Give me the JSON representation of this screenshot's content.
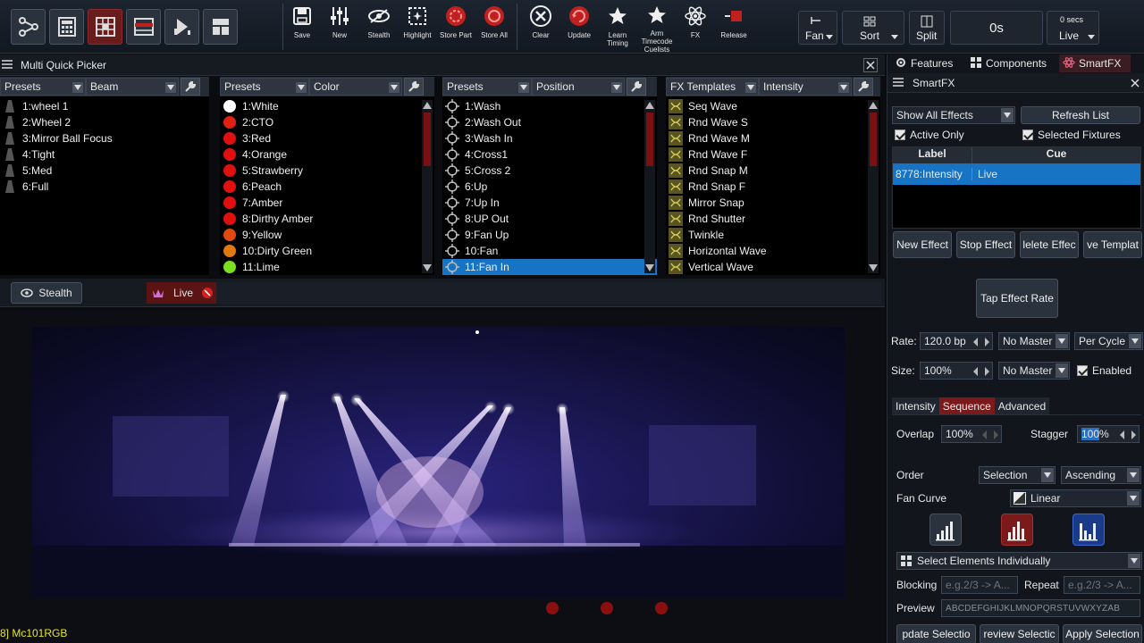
{
  "colors": {
    "accent_red": "#c0201e",
    "selection_blue": "#1773c4",
    "status_yellow": "#e6e62a"
  },
  "toolbar": {
    "mode_icons": [
      "nodes-icon",
      "calculator-icon",
      "grid-icon",
      "table-icon",
      "playback-icon",
      "layout-icon"
    ],
    "buttons": [
      {
        "label": "Save",
        "icon": "save-icon"
      },
      {
        "label": "New",
        "icon": "faders-icon"
      },
      {
        "label": "Stealth",
        "icon": "eye-icon"
      },
      {
        "label": "Highlight",
        "icon": "highlight-icon"
      },
      {
        "label": "Store Part",
        "icon": "store-part-icon"
      },
      {
        "label": "Store All",
        "icon": "store-all-icon"
      },
      {
        "label": "Clear",
        "icon": "clear-icon"
      },
      {
        "label": "Update",
        "icon": "update-icon"
      },
      {
        "label": "Learn Timing",
        "icon": "star-icon"
      },
      {
        "label": "Arm Timecode Cuelists",
        "icon": "star-icon"
      },
      {
        "label": "FX",
        "icon": "atom-icon"
      },
      {
        "label": "Release",
        "icon": "release-icon"
      }
    ],
    "fan_label": "Fan",
    "sort_label": "Sort",
    "split_label": "Split",
    "time_value": "0s",
    "live_secs": "0 secs",
    "live_label": "Live"
  },
  "picker": {
    "title": "Multi Quick Picker",
    "columns": [
      {
        "header_left": "Presets",
        "header_right": "Beam",
        "items": [
          "1:wheel 1",
          "2:Wheel 2",
          "3:Mirror Ball Focus",
          "4:Tight",
          "5:Med",
          "6:Full"
        ]
      },
      {
        "header_left": "Presets",
        "header_right": "Color",
        "items": [
          "1:White",
          "2:CTO",
          "3:Red",
          "4:Orange",
          "5:Strawberry",
          "6:Peach",
          "7:Amber",
          "8:Dirthy Amber",
          "9:Yellow",
          "10:Dirty Green",
          "11:Lime"
        ],
        "swatches": [
          "#ffffff",
          "#e02010",
          "#e01010",
          "#e01010",
          "#e01010",
          "#e01010",
          "#e01010",
          "#e01010",
          "#e04a10",
          "#e07a10",
          "#7ae020"
        ]
      },
      {
        "header_left": "Presets",
        "header_right": "Position",
        "items": [
          "1:Wash",
          "2:Wash Out",
          "3:Wash In",
          "4:Cross1",
          "5:Cross 2",
          "6:Up",
          "7:Up In",
          "8:UP Out",
          "9:Fan Up",
          "10:Fan",
          "11:Fan In"
        ],
        "selected": "11:Fan In"
      },
      {
        "header_left": "FX Templates",
        "header_right": "Intensity",
        "items": [
          "Seq Wave",
          "Rnd Wave S",
          "Rnd Wave M",
          "Rnd Wave F",
          "Rnd Snap M",
          "Rnd Snap F",
          "Mirror Snap",
          "Rnd Shutter",
          "Twinkle",
          "Horizontal Wave",
          "Vertical Wave"
        ]
      }
    ]
  },
  "viewbar": {
    "stealth_label": "Stealth",
    "live_label": "Live"
  },
  "status": {
    "fixture_text": "8] Mc101RGB"
  },
  "rpanel": {
    "tabs": [
      "Features",
      "Components",
      "SmartFX"
    ],
    "title": "SmartFX",
    "show_filter": "Show All Effects",
    "refresh_label": "Refresh List",
    "active_only": "Active Only",
    "selected_fixtures": "Selected Fixtures",
    "table_headers": [
      "Label",
      "Cue"
    ],
    "table_rows": [
      {
        "label": "8778:Intensity",
        "cue": "Live"
      }
    ],
    "actions": [
      "New Effect",
      "Stop Effect",
      "lelete Effec",
      "ve Templat"
    ],
    "tap_rate": "Tap Effect Rate",
    "rate_label": "Rate:",
    "rate_value": "120.0 bp",
    "rate_master": "No Master",
    "rate_mode": "Per Cycle",
    "size_label": "Size:",
    "size_value": "100%",
    "size_master": "No Master",
    "enabled_label": "Enabled",
    "subtabs": [
      "Intensity",
      "Sequence",
      "Advanced"
    ],
    "overlap_label": "Overlap",
    "overlap_value": "100%",
    "stagger_label": "Stagger",
    "stagger_value": "100",
    "stagger_unit": "%",
    "order_label": "Order",
    "order_value": "Selection",
    "order_dir": "Ascending",
    "fancurve_label": "Fan Curve",
    "fancurve_value": "Linear",
    "select_mode": "Select Elements Individually",
    "blocking_label": "Blocking",
    "blocking_placeholder": "e.g.2/3 -> A...",
    "repeat_label": "Repeat",
    "repeat_placeholder": "e.g.2/3 -> A...",
    "preview_label": "Preview",
    "preview_value": "ABCDEFGHIJKLMNOPQRSTUVWXYZAB",
    "bottom_actions": [
      "pdate Selectio",
      "review Selectic",
      "Apply Selection"
    ]
  }
}
